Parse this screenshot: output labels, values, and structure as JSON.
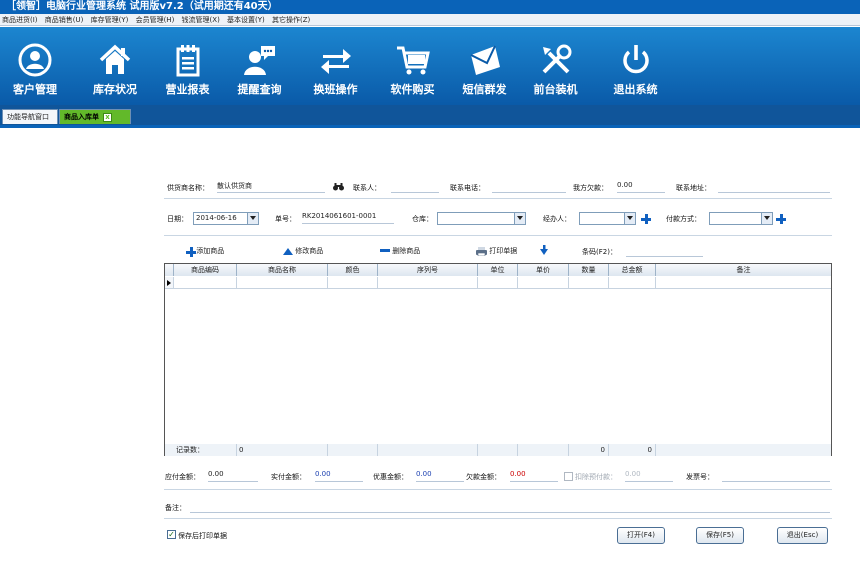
{
  "window": {
    "title": "［领智］电脑行业管理系统 试用版v7.2（试用期还有40天）"
  },
  "menu": {
    "items": [
      "商品进货(I)",
      "商品销售(U)",
      "库存管理(Y)",
      "会员管理(H)",
      "钱流管理(X)",
      "基本设置(Y)",
      "其它操作(Z)"
    ]
  },
  "toolbar": {
    "buttons": [
      {
        "label": "客户管理",
        "icon": "user-circle-icon"
      },
      {
        "label": "库存状况",
        "icon": "home-icon"
      },
      {
        "label": "营业报表",
        "icon": "notepad-icon"
      },
      {
        "label": "提醒查询",
        "icon": "chat-user-icon"
      },
      {
        "label": "换班操作",
        "icon": "swap-arrows-icon"
      },
      {
        "label": "软件购买",
        "icon": "shopping-cart-icon"
      },
      {
        "label": "短信群发",
        "icon": "envelope-icon"
      },
      {
        "label": "前台装机",
        "icon": "tools-icon"
      },
      {
        "label": "退出系统",
        "icon": "power-icon"
      }
    ]
  },
  "tabs": [
    {
      "label": "功能导航窗口"
    },
    {
      "label": "商品入库单",
      "close": "x"
    }
  ],
  "form": {
    "supplier_label": "供货商名称：",
    "supplier_value": "散认供货商",
    "contact_label": "联系人：",
    "phone_label": "联系电话：",
    "debt_label": "我方欠款：",
    "debt_value": "0.00",
    "address_label": "联系地址：",
    "date_label": "日期：",
    "date_value": "2014-06-16",
    "order_label": "单号：",
    "order_value": "RK2014061601-0001",
    "warehouse_label": "仓库：",
    "handler_label": "经办人：",
    "payment_label": "付款方式："
  },
  "actions": {
    "add": "添加商品",
    "edit": "修改商品",
    "delete": "删除商品",
    "print": "打印单据",
    "barcode_label": "条码(F2)："
  },
  "grid": {
    "columns": [
      "商品编码",
      "商品名称",
      "颜色",
      "序列号",
      "单位",
      "单价",
      "数量",
      "总金额",
      "备注"
    ],
    "footer_label": "记录数：",
    "footer_count": "0",
    "qty_total": "0",
    "amount_total": "0"
  },
  "summary": {
    "payable_label": "应付金额：",
    "payable_value": "0.00",
    "paid_label": "实付金额：",
    "paid_value": "0.00",
    "discount_label": "优惠金额：",
    "discount_value": "0.00",
    "owed_label": "欠款金额：",
    "owed_value": "0.00",
    "prepaid_label": "扣除预付款：",
    "prepaid_value": "0.00",
    "invoice_label": "发票号："
  },
  "notes_label": "备注：",
  "print_after_save": "保存后打印单据",
  "buttons": {
    "open": "打开(F4)",
    "save": "保存(F5)",
    "exit": "退出(Esc)"
  },
  "colors": {
    "toolbar": "#0a63b8",
    "tab_active": "#62b92a",
    "owed": "#cc0000",
    "paid": "#1a3fb0"
  }
}
